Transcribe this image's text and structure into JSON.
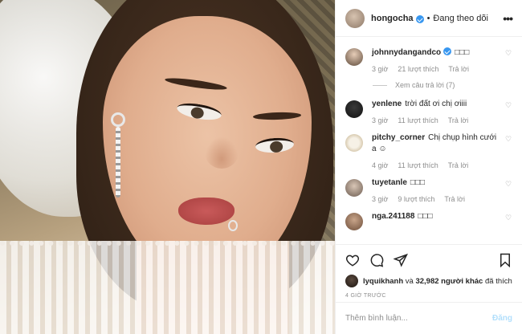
{
  "header": {
    "username": "hongocha",
    "separator": "•",
    "follow_status": "Đang theo dõi",
    "more_icon": "more-horizontal-icon"
  },
  "comments": [
    {
      "username": "johnnydangandco",
      "verified": true,
      "text": "□□□",
      "time": "3 giờ",
      "likes": "21 lượt thích",
      "reply": "Trả lời",
      "view_replies": "Xem câu trả lời (7)"
    },
    {
      "username": "yenlene",
      "text": "trời đất ơi chị ơiiii",
      "time": "3 giờ",
      "likes": "11 lượt thích",
      "reply": "Trả lời"
    },
    {
      "username": "pitchy_corner",
      "text": "Chị chụp hình cưới a ☺",
      "time": "4 giờ",
      "likes": "11 lượt thích",
      "reply": "Trả lời"
    },
    {
      "username": "tuyetanle",
      "text": "□□□",
      "time": "3 giờ",
      "likes": "9 lượt thích",
      "reply": "Trả lời"
    },
    {
      "username": "nga.241188",
      "text": "□□□",
      "time": "",
      "likes": "",
      "reply": ""
    }
  ],
  "actions": {
    "like_icon": "heart-icon",
    "comment_icon": "comment-icon",
    "share_icon": "share-icon",
    "save_icon": "bookmark-icon",
    "liked_by_user": "lyquikhanh",
    "liked_by_connector": " và ",
    "liked_by_count": "32,982 người khác",
    "liked_by_suffix": " đã thích",
    "time_ago": "4 GIỜ TRƯỚC"
  },
  "add_comment": {
    "placeholder": "Thêm bình luận...",
    "post_label": "Đăng"
  },
  "colors": {
    "verified": "#3897f0",
    "muted": "#8e8e8e",
    "post_disabled": "#b2dffc"
  }
}
